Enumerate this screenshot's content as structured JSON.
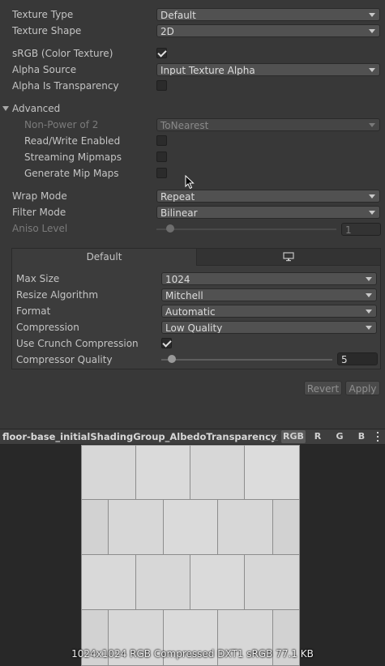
{
  "fields": {
    "texture_type": {
      "label": "Texture Type",
      "value": "Default"
    },
    "texture_shape": {
      "label": "Texture Shape",
      "value": "2D"
    },
    "srgb": {
      "label": "sRGB (Color Texture)",
      "checked": true
    },
    "alpha_source": {
      "label": "Alpha Source",
      "value": "Input Texture Alpha"
    },
    "alpha_is_transparency": {
      "label": "Alpha Is Transparency",
      "checked": false
    }
  },
  "advanced": {
    "label": "Advanced",
    "non_power_of_2": {
      "label": "Non-Power of 2",
      "value": "ToNearest"
    },
    "read_write": {
      "label": "Read/Write Enabled",
      "checked": false
    },
    "streaming_mipmaps": {
      "label": "Streaming Mipmaps",
      "checked": false
    },
    "generate_mipmaps": {
      "label": "Generate Mip Maps",
      "checked": false
    }
  },
  "wrap_mode": {
    "label": "Wrap Mode",
    "value": "Repeat"
  },
  "filter_mode": {
    "label": "Filter Mode",
    "value": "Bilinear"
  },
  "aniso_level": {
    "label": "Aniso Level",
    "value": "1",
    "level": 1
  },
  "platform": {
    "tab_default": "Default",
    "tab_standalone_icon": "monitor-icon",
    "max_size": {
      "label": "Max Size",
      "value": "1024"
    },
    "resize_algorithm": {
      "label": "Resize Algorithm",
      "value": "Mitchell"
    },
    "format": {
      "label": "Format",
      "value": "Automatic"
    },
    "compression": {
      "label": "Compression",
      "value": "Low Quality"
    },
    "crunch": {
      "label": "Use Crunch Compression",
      "checked": true
    },
    "compressor_quality": {
      "label": "Compressor Quality",
      "value": "5",
      "level": 5
    }
  },
  "buttons": {
    "revert": "Revert",
    "apply": "Apply"
  },
  "preview": {
    "title": "floor-base_initialShadingGroup_AlbedoTransparency",
    "channels": [
      "RGB",
      "R",
      "G",
      "B"
    ],
    "info": "1024x1024  RGB Compressed DXT1 sRGB  77.1 KB"
  }
}
